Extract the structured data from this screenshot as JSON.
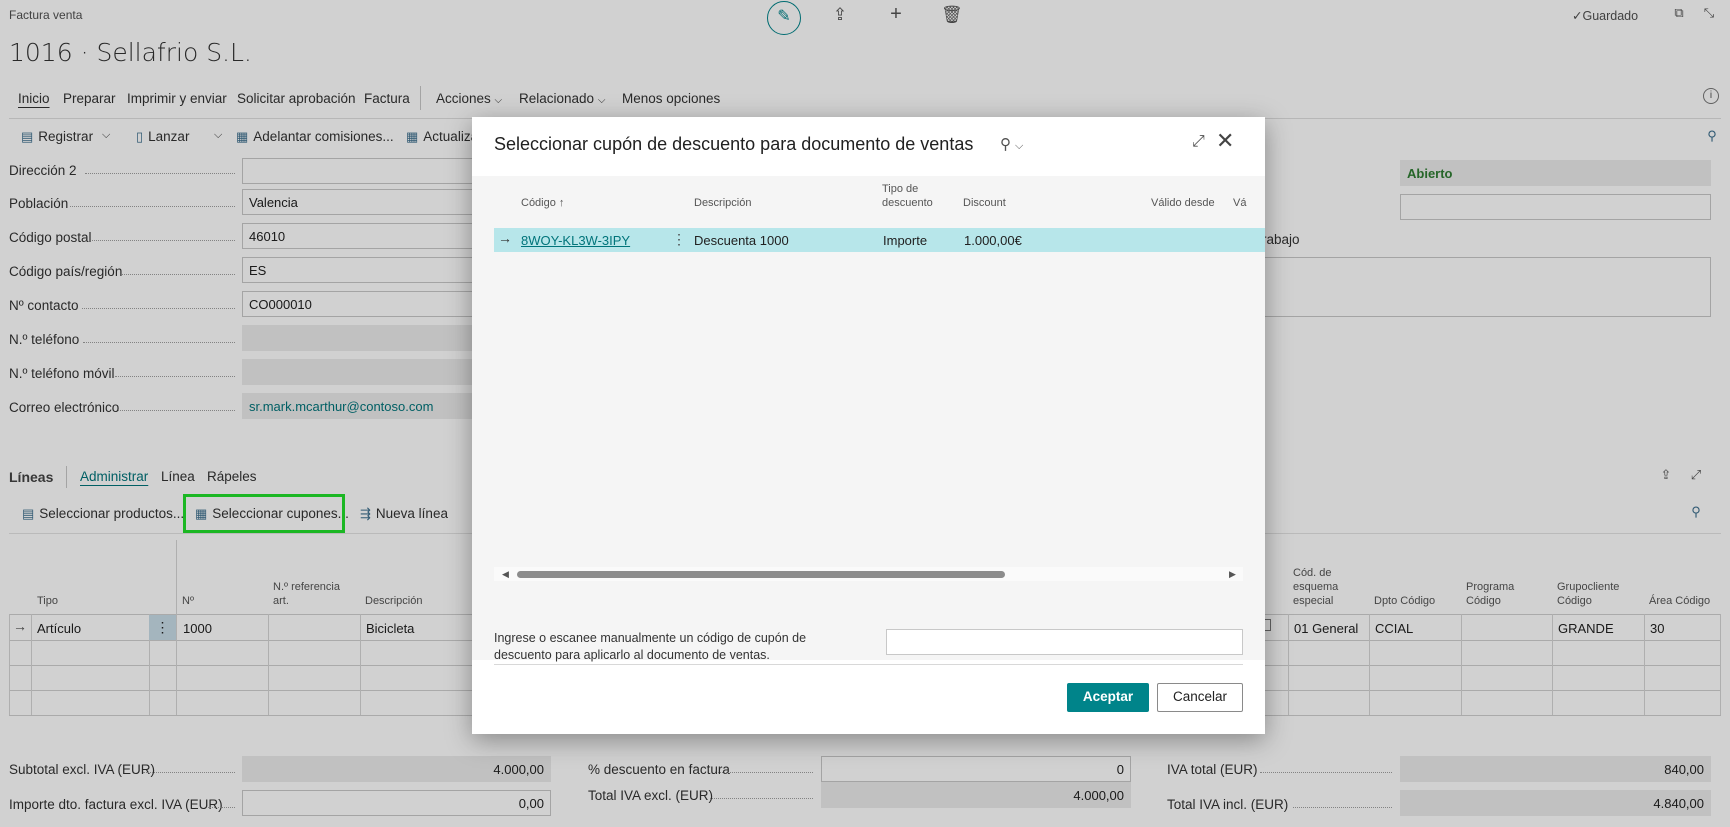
{
  "header": {
    "breadcrumb": "Factura venta",
    "title": "1016 · Sellafrio S.L.",
    "status_saved": "Guardado"
  },
  "menu": {
    "tabs": [
      "Inicio",
      "Preparar",
      "Imprimir y enviar",
      "Solicitar aprobación",
      "Factura",
      "Acciones",
      "Relacionado",
      "Menos opciones"
    ]
  },
  "toolbar": {
    "register": "Registrar",
    "launch": "Lanzar",
    "advance_commissions": "Adelantar comisiones...",
    "update": "Actualiza"
  },
  "form": {
    "direccion2_label": "Dirección 2",
    "direccion2_value": "",
    "poblacion_label": "Población",
    "poblacion_value": "Valencia",
    "codigo_postal_label": "Código postal",
    "codigo_postal_value": "46010",
    "pais_label": "Código país/región",
    "pais_value": "ES",
    "contacto_label": "Nº contacto",
    "contacto_value": "CO000010",
    "telefono_label": "N.º teléfono",
    "movil_label": "N.º teléfono móvil",
    "correo_label": "Correo electrónico",
    "correo_value": "sr.mark.mcarthur@contoso.com",
    "estado_value": "Abierto",
    "right_fragment": "rabajo"
  },
  "lines": {
    "title": "Líneas",
    "tabs": [
      "Administrar",
      "Línea",
      "Rápeles"
    ],
    "actions": {
      "select_products": "Seleccionar productos...",
      "select_coupons": "Seleccionar cupones...",
      "new_line": "Nueva línea"
    },
    "headers": {
      "tipo": "Tipo",
      "no": "Nº",
      "ref": "N.º referencia art.",
      "descripcion": "Descripción",
      "esquema": "Cód. de esquema especial",
      "dpto": "Dpto Código",
      "programa": "Programa Código",
      "grupo": "Grupocliente Código",
      "area": "Área Código"
    },
    "row": {
      "tipo": "Artículo",
      "no": "1000",
      "descripcion": "Bicicleta",
      "esquema": "01 General",
      "dpto": "CCIAL",
      "grupo": "GRANDE",
      "area": "30"
    }
  },
  "totals": {
    "subtotal_label": "Subtotal excl. IVA (EUR)",
    "subtotal_value": "4.000,00",
    "importe_dto_label": "Importe dto. factura excl. IVA (EUR)",
    "importe_dto_value": "0,00",
    "pct_descuento_label": "% descuento en factura",
    "pct_descuento_value": "0",
    "total_excl_label": "Total IVA excl. (EUR)",
    "total_excl_value": "4.000,00",
    "iva_total_label": "IVA total (EUR)",
    "iva_total_value": "840,00",
    "total_incl_label": "Total IVA incl. (EUR)",
    "total_incl_value": "4.840,00"
  },
  "dialog": {
    "title": "Seleccionar cupón de descuento para documento de ventas",
    "columns": {
      "codigo": "Código",
      "descripcion": "Descripción",
      "tipo": "Tipo de descuento",
      "discount": "Discount",
      "valido_desde": "Válido desde",
      "valido_hasta": "Vá"
    },
    "row": {
      "codigo": "8WOY-KL3W-3IPY",
      "descripcion": "Descuenta 1000",
      "tipo": "Importe",
      "discount": "1.000,00€"
    },
    "manual_text": "Ingrese o escanee manualmente un código de cupón de descuento para aplicarlo al documento de ventas.",
    "manual_value": "",
    "accept": "Aceptar",
    "cancel": "Cancelar"
  },
  "colors": {
    "accent": "#00848a",
    "selected_row": "#b7e6ea",
    "highlight_box": "#22e02b",
    "status_green": "#2f7d32"
  }
}
